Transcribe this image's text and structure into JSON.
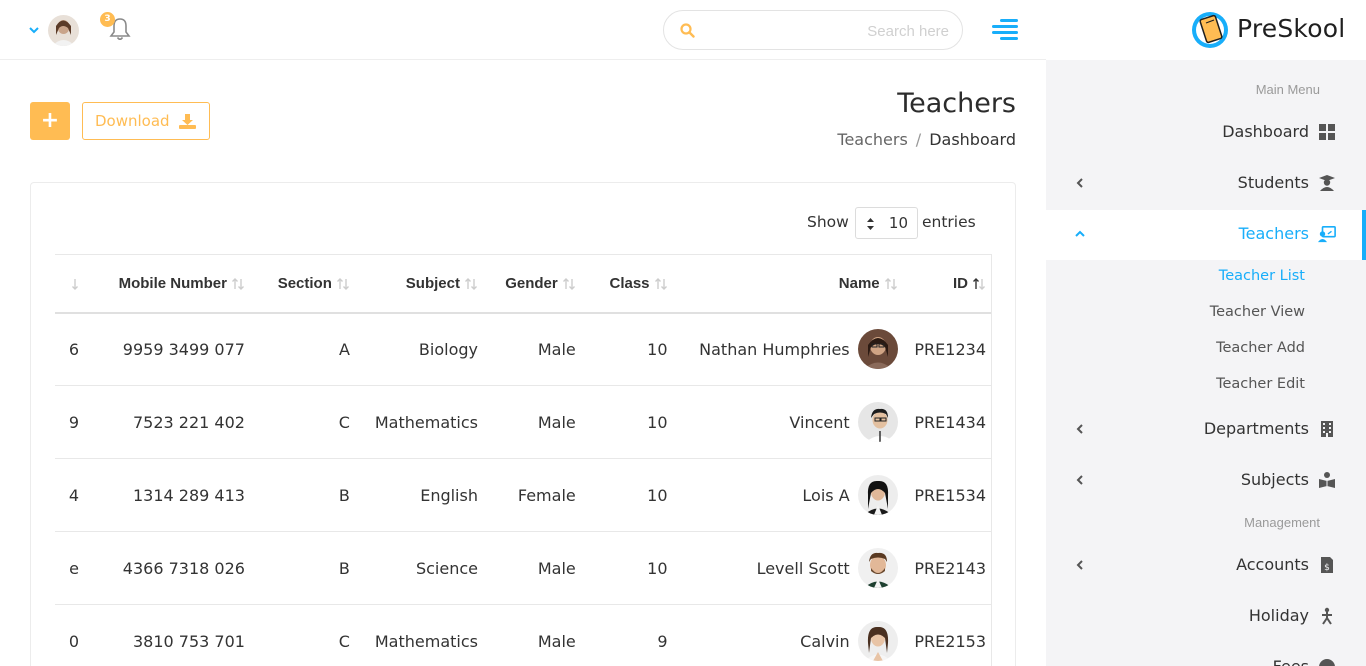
{
  "header": {
    "search_placeholder": "Search here",
    "notification_count": "3",
    "icons": [
      "chevron-down-icon",
      "avatar",
      "bell-icon",
      "search-icon",
      "menu-toggle-icon"
    ]
  },
  "sidebar": {
    "logo_text": "PreSkool",
    "main_menu_title": "Main Menu",
    "management_title": "Management",
    "items": [
      {
        "label": "Dashboard",
        "icon": "dashboard-icon"
      },
      {
        "label": "Students",
        "icon": "student-icon"
      },
      {
        "label": "Teachers",
        "icon": "teacher-icon",
        "active": true
      },
      {
        "label": "Departments",
        "icon": "building-icon"
      },
      {
        "label": "Subjects",
        "icon": "book-reader-icon"
      },
      {
        "label": "Accounts",
        "icon": "invoice-icon"
      },
      {
        "label": "Holiday",
        "icon": "holiday-icon"
      },
      {
        "label": "Fees",
        "icon": "fees-icon"
      }
    ],
    "teachers_submenu": [
      "Teacher List",
      "Teacher View",
      "Teacher Add",
      "Teacher Edit"
    ]
  },
  "page": {
    "title": "Teachers",
    "breadcrumb": [
      "Teachers",
      "Dashboard"
    ],
    "add_label": "+",
    "download_label": "Download"
  },
  "table": {
    "show_label": "Show",
    "entries_value": "10",
    "entries_label": "entries",
    "columns": [
      "Mobile Number",
      "Section",
      "Subject",
      "Gender",
      "Class",
      "Name",
      "ID"
    ],
    "partial_col_chars": [
      "6",
      "9",
      "4",
      "e",
      "0"
    ],
    "rows": [
      {
        "mobile": "9959 3499 077",
        "section": "A",
        "subject": "Biology",
        "gender": "Male",
        "class": "10",
        "name": "Nathan Humphries",
        "id": "PRE1234"
      },
      {
        "mobile": "7523 221 402",
        "section": "C",
        "subject": "Mathematics",
        "gender": "Male",
        "class": "10",
        "name": "Vincent",
        "id": "PRE1434"
      },
      {
        "mobile": "1314 289 413",
        "section": "B",
        "subject": "English",
        "gender": "Female",
        "class": "10",
        "name": "Lois A",
        "id": "PRE1534"
      },
      {
        "mobile": "4366 7318 026",
        "section": "B",
        "subject": "Science",
        "gender": "Male",
        "class": "10",
        "name": "Levell Scott",
        "id": "PRE2143"
      },
      {
        "mobile": "3810 753 701",
        "section": "C",
        "subject": "Mathematics",
        "gender": "Male",
        "class": "9",
        "name": "Calvin",
        "id": "PRE2153"
      }
    ]
  },
  "colors": {
    "accent": "#18aefa",
    "warning": "#ffbc53",
    "sidebar_bg": "#f4f4f6"
  }
}
